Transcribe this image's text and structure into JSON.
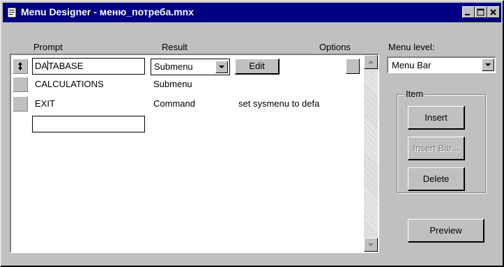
{
  "window": {
    "title": "Menu Designer - меню_потреба.mnx"
  },
  "columns": {
    "prompt": "Prompt",
    "result": "Result",
    "options": "Options"
  },
  "rows": [
    {
      "prompt": "DA",
      "prompt_rest": "TABASE",
      "result": "Submenu",
      "action": "Edit",
      "detail": ""
    },
    {
      "prompt": "CALCULATIONS",
      "result": "Submenu",
      "detail": ""
    },
    {
      "prompt": "EXIT",
      "result": "Command",
      "detail": "set sysmenu to defa"
    }
  ],
  "menu_level": {
    "label": "Menu level:",
    "value": "Menu Bar"
  },
  "item_group": {
    "label": "Item",
    "insert": "Insert",
    "insert_bar": "Insert Bar...",
    "delete": "Delete"
  },
  "preview_label": "Preview",
  "colors": {
    "titlebar": "#000080",
    "face": "#c0c0c0",
    "disabled_text": "#808080"
  }
}
